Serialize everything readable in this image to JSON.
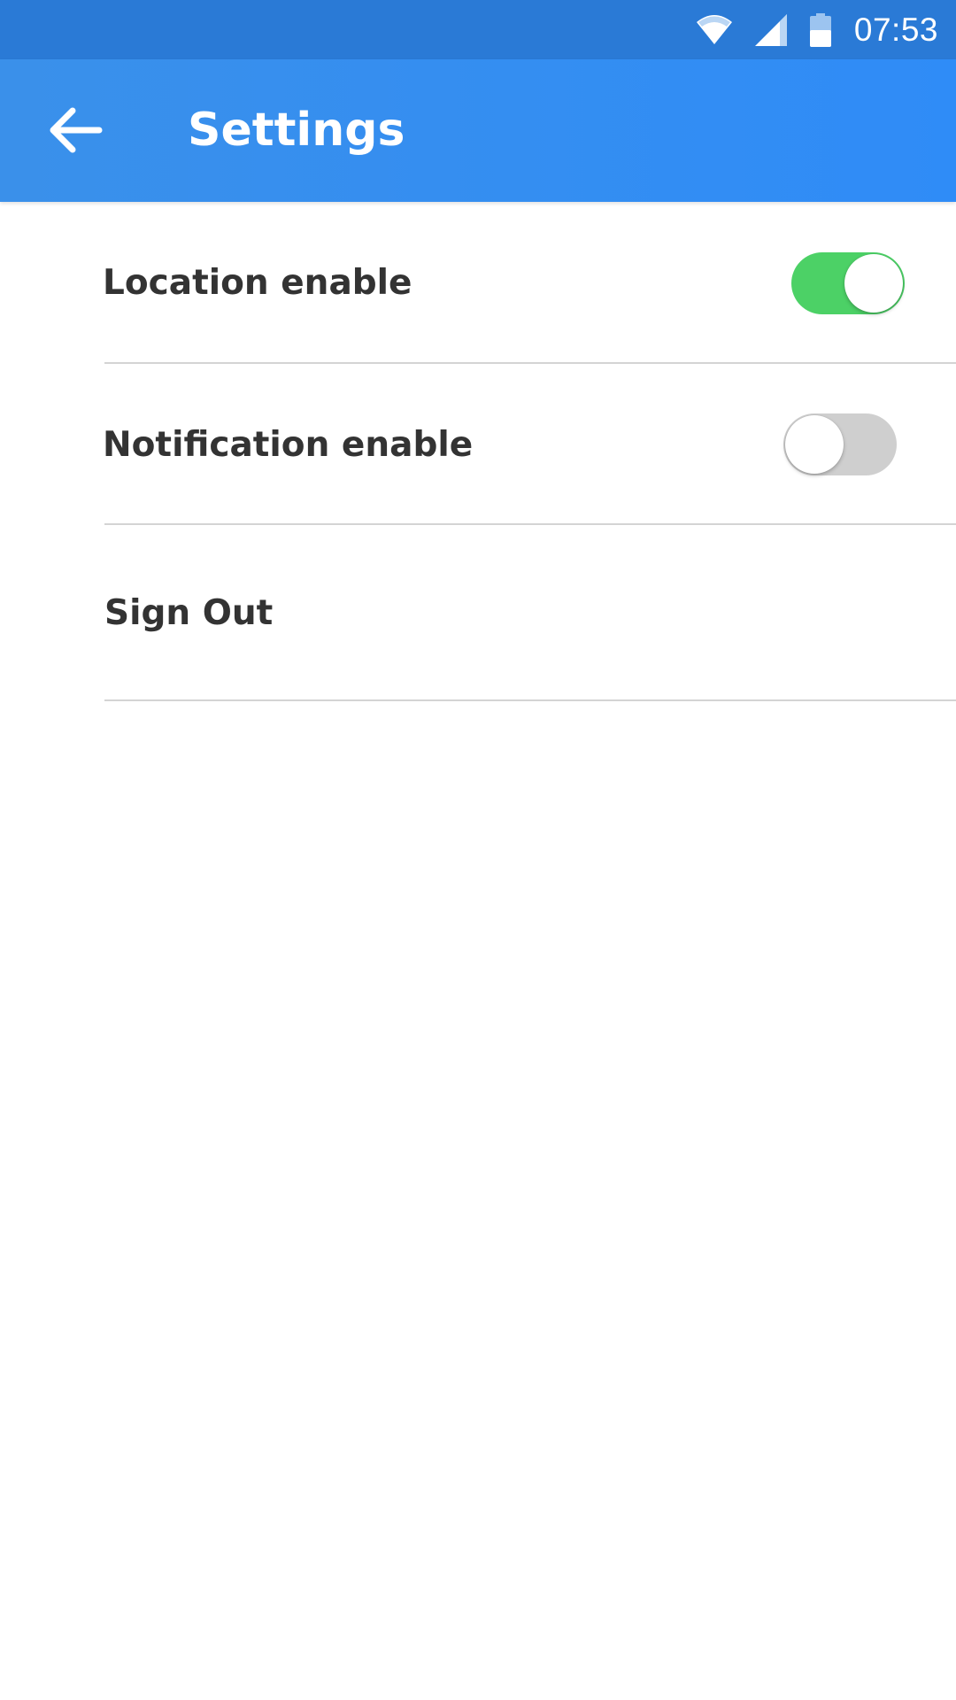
{
  "status_bar": {
    "time": "07:53",
    "icons": [
      "wifi-icon",
      "cellular-signal-icon",
      "battery-icon"
    ]
  },
  "app_bar": {
    "title": "Settings",
    "back_icon": "arrow-left-icon"
  },
  "settings": {
    "location": {
      "label": "Location enable",
      "enabled": true
    },
    "notification": {
      "label": "Notification enable",
      "enabled": false
    },
    "sign_out": {
      "label": "Sign Out"
    }
  },
  "colors": {
    "status_bar": "#2a7ad6",
    "app_bar": "#3a90ea",
    "toggle_on": "#4cd166",
    "toggle_off": "#cfcfcf",
    "label_text": "#333333"
  }
}
